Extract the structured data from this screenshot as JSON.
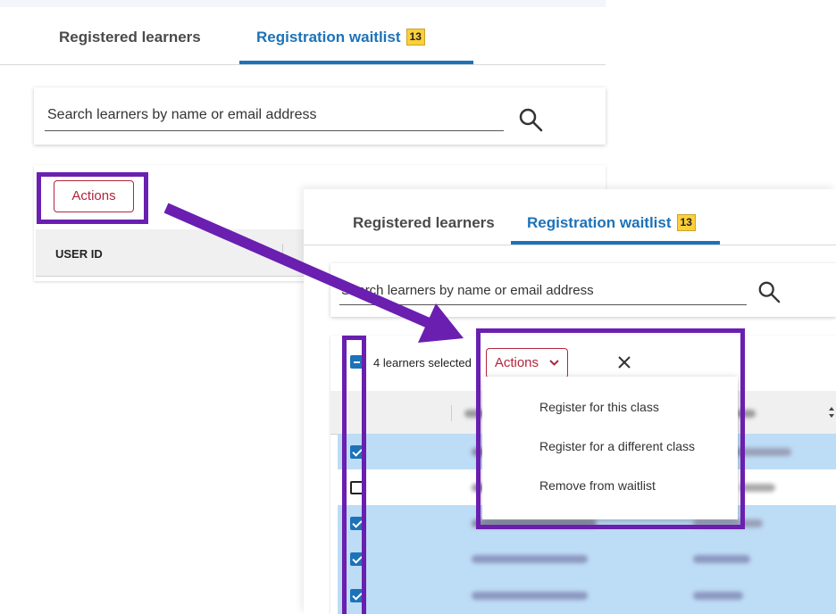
{
  "back_view": {
    "tabs": [
      {
        "label": "Registered learners"
      },
      {
        "label": "Registration waitlist",
        "badge": "13"
      }
    ],
    "search": {
      "placeholder": "Search learners by name or email address"
    },
    "actions_label": "Actions",
    "table": {
      "columns": [
        "USER ID"
      ]
    }
  },
  "front_view": {
    "tabs": [
      {
        "label": "Registered learners"
      },
      {
        "label": "Registration waitlist",
        "badge": "13"
      }
    ],
    "search": {
      "placeholder": "Search learners by name or email address"
    },
    "selection_text": "4 learners selected",
    "actions_label": "Actions",
    "menu": [
      {
        "label": "Register for this class"
      },
      {
        "label": "Register for a different class"
      },
      {
        "label": "Remove from waitlist"
      }
    ],
    "rows": [
      {
        "checked": true
      },
      {
        "checked": false
      },
      {
        "checked": true
      },
      {
        "checked": true
      },
      {
        "checked": true
      }
    ]
  },
  "colors": {
    "highlight": "#6a1fb0",
    "tab_active": "#1d72b8",
    "badge": "#ffcf3a",
    "actions": "#b3253a",
    "selected_row": "#bddcf5"
  },
  "icons": [
    "search-icon",
    "search-icon",
    "close-icon",
    "chevron-down-icon",
    "sort-icon"
  ]
}
